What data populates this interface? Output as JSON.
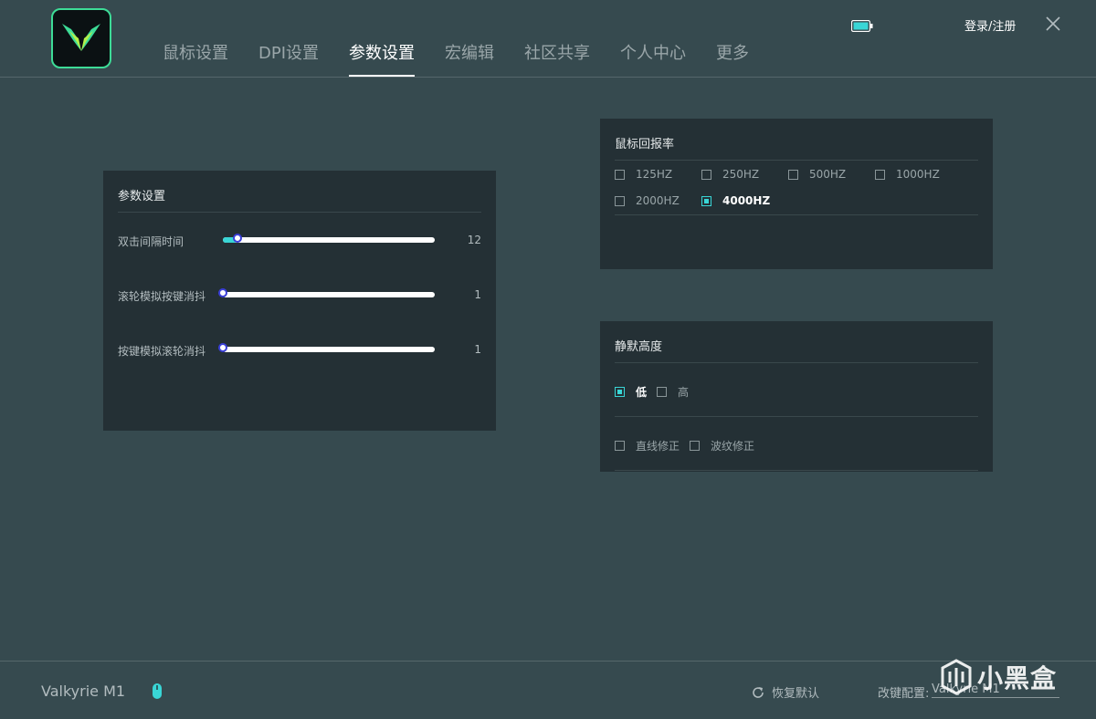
{
  "nav": {
    "tabs": [
      "鼠标设置",
      "DPI设置",
      "参数设置",
      "宏编辑",
      "社区共享",
      "个人中心",
      "更多"
    ],
    "active_index": 2
  },
  "header": {
    "login_label": "登录/注册"
  },
  "params_panel": {
    "title": "参数设置",
    "sliders": [
      {
        "label": "双击间隔时间",
        "value": "12",
        "level": 0.07
      },
      {
        "label": "滚轮模拟按键消抖",
        "value": "1",
        "level": 0
      },
      {
        "label": "按键模拟滚轮消抖",
        "value": "1",
        "level": 0
      }
    ]
  },
  "polling_panel": {
    "title": "鼠标回报率",
    "options": [
      {
        "label": "125HZ",
        "checked": false
      },
      {
        "label": "250HZ",
        "checked": false
      },
      {
        "label": "500HZ",
        "checked": false
      },
      {
        "label": "1000HZ",
        "checked": false
      },
      {
        "label": "2000HZ",
        "checked": false
      },
      {
        "label": "4000HZ",
        "checked": true
      }
    ]
  },
  "lod_panel": {
    "title": "静默高度",
    "height_options": [
      {
        "label": "低",
        "checked": true
      },
      {
        "label": "高",
        "checked": false
      }
    ],
    "correction_options": [
      {
        "label": "直线修正",
        "checked": false
      },
      {
        "label": "波纹修正",
        "checked": false
      }
    ]
  },
  "footer": {
    "device_name": "Valkyrie M1",
    "restore_label": "恢复默认",
    "config_label": "改键配置:",
    "config_value": "Valkyrie M1"
  },
  "watermark": "小黑盒",
  "colors": {
    "accent": "#39d6d6",
    "logo_border": "#3ddc97",
    "background": "#364a4f",
    "panel": "#243035"
  }
}
